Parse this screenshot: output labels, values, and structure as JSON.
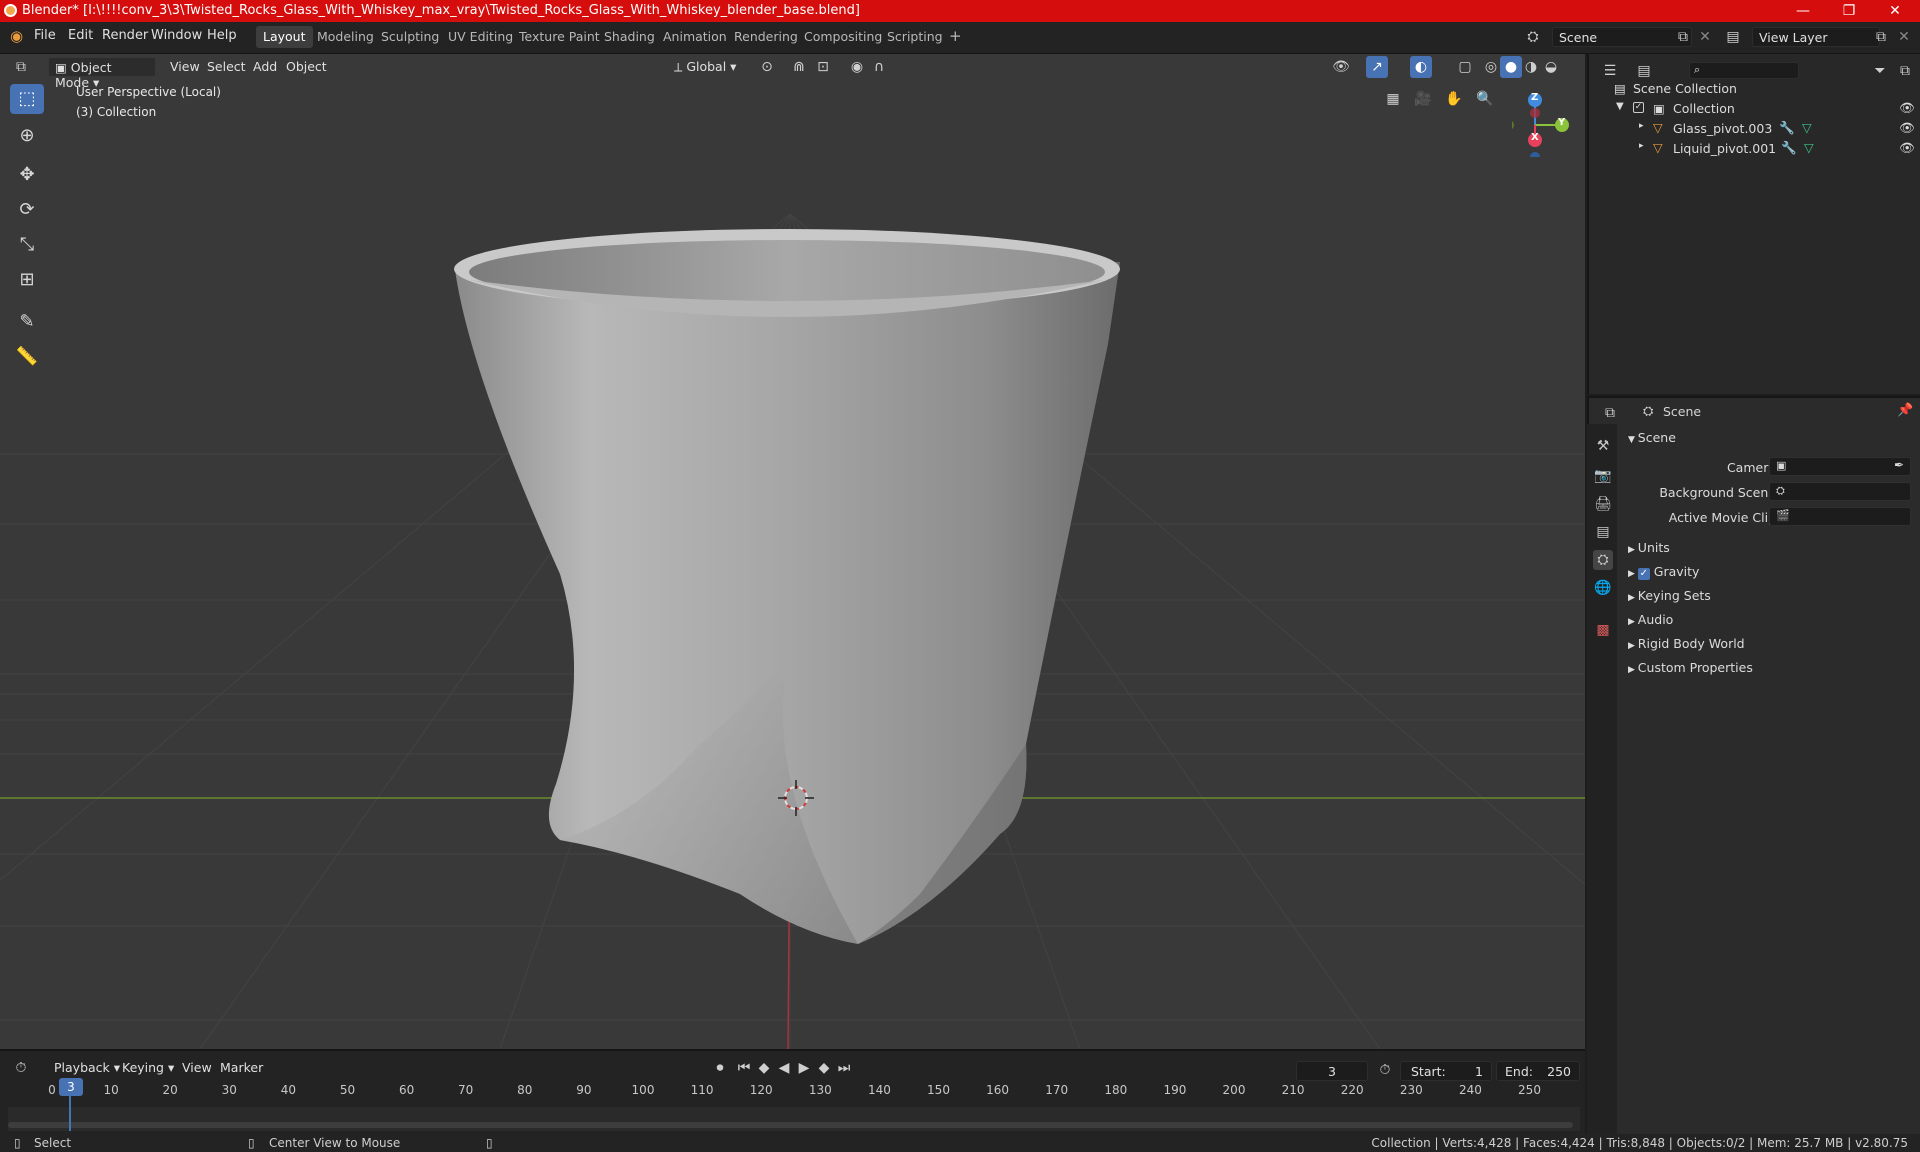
{
  "window": {
    "title": "Blender* [I:\\!!!!conv_3\\3\\Twisted_Rocks_Glass_With_Whiskey_max_vray\\Twisted_Rocks_Glass_With_Whiskey_blender_base.blend]",
    "minimize": "—",
    "maximize": "❐",
    "close": "✕"
  },
  "menu": [
    "File",
    "Edit",
    "Render",
    "Window",
    "Help"
  ],
  "workspaces": [
    "Layout",
    "Modeling",
    "Sculpting",
    "UV Editing",
    "Texture Paint",
    "Shading",
    "Animation",
    "Rendering",
    "Compositing",
    "Scripting"
  ],
  "active_workspace": "Layout",
  "add_workspace": "+",
  "scene_field": "Scene",
  "view_layer_field": "View Layer",
  "viewport": {
    "mode": "Object Mode",
    "menus": [
      "View",
      "Select",
      "Add",
      "Object"
    ],
    "transform_orientation": "Global",
    "overlay_title": "User Perspective (Local)",
    "overlay_collection": "(3) Collection",
    "gizmo": {
      "z": "Z",
      "y": "Y",
      "x": "X"
    }
  },
  "tools": [
    {
      "name": "select-box-tool",
      "glyph": "⬚"
    },
    {
      "name": "cursor-tool",
      "glyph": "⊕"
    },
    {
      "name": "move-tool",
      "glyph": "✥"
    },
    {
      "name": "rotate-tool",
      "glyph": "⟳"
    },
    {
      "name": "scale-tool",
      "glyph": "⤡"
    },
    {
      "name": "transform-tool",
      "glyph": "⊞"
    },
    {
      "name": "annotate-tool",
      "glyph": "✎"
    },
    {
      "name": "measure-tool",
      "glyph": "📐"
    }
  ],
  "outliner": {
    "search_placeholder": "",
    "root": "Scene Collection",
    "collection": "Collection",
    "objects": [
      "Glass_pivot.003",
      "Liquid_pivot.001"
    ]
  },
  "properties": {
    "header": "Scene",
    "panel": "Scene",
    "fields": [
      {
        "label": "Camera"
      },
      {
        "label": "Background Scene"
      },
      {
        "label": "Active Movie Clip"
      }
    ],
    "subpanels": [
      "Units",
      "Gravity",
      "Keying Sets",
      "Audio",
      "Rigid Body World",
      "Custom Properties"
    ],
    "gravity_checked": true
  },
  "timeline": {
    "menus": [
      "Playback",
      "Keying",
      "View",
      "Marker"
    ],
    "current_frame": "3",
    "start_label": "Start:",
    "start": "1",
    "end_label": "End:",
    "end": "250",
    "ticks": [
      "0",
      "10",
      "20",
      "30",
      "40",
      "50",
      "60",
      "70",
      "80",
      "90",
      "100",
      "110",
      "120",
      "130",
      "140",
      "150",
      "160",
      "170",
      "180",
      "190",
      "200",
      "210",
      "220",
      "230",
      "240",
      "250"
    ]
  },
  "status": {
    "select": "Select",
    "center_view": "Center View to Mouse",
    "stats": "Collection | Verts:4,428 | Faces:4,424 | Tris:8,848 | Objects:0/2 | Mem: 25.7 MB | v2.80.75"
  },
  "colors": {
    "title_bar": "#d50d0d",
    "accent": "#4772b3",
    "viewport_bg": "#393939",
    "object_orange": "#e89a3c",
    "x_axis": "#e8415b",
    "y_axis": "#8bc43a",
    "z_axis": "#3f8ce0"
  }
}
